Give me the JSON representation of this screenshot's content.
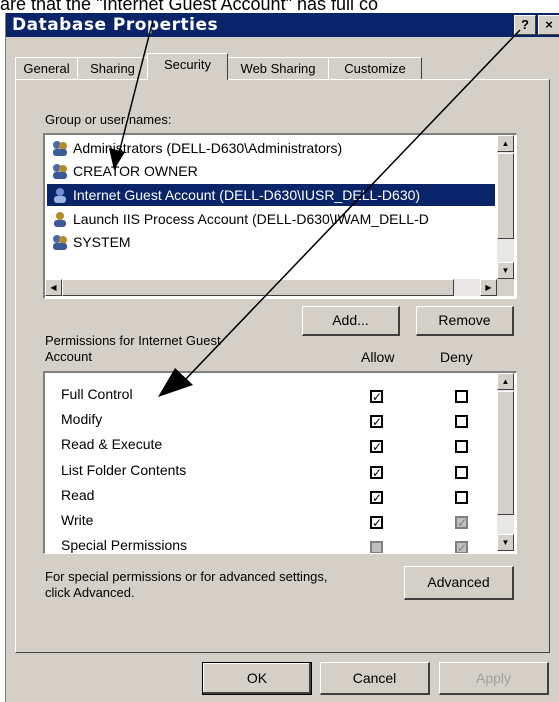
{
  "caption": "are that the \"Internet Guest Account\" has full co",
  "window": {
    "title": "Database Properties",
    "help_btn": "?",
    "close_btn": "×"
  },
  "tabs": [
    "General",
    "Sharing",
    "Security",
    "Web Sharing",
    "Customize"
  ],
  "group_label": "Group or user names:",
  "users": [
    {
      "label": "Administrators (DELL-D630\\Administrators)",
      "selected": false
    },
    {
      "label": "CREATOR OWNER",
      "selected": false
    },
    {
      "label": "Internet Guest Account (DELL-D630\\IUSR_DELL-D630)",
      "selected": true
    },
    {
      "label": "Launch IIS Process Account (DELL-D630\\IWAM_DELL-D",
      "selected": false
    },
    {
      "label": "SYSTEM",
      "selected": false
    }
  ],
  "buttons": {
    "add": "Add...",
    "remove": "Remove",
    "advanced": "Advanced",
    "ok": "OK",
    "cancel": "Cancel",
    "apply": "Apply"
  },
  "permissions_title_1": "Permissions for Internet Guest",
  "permissions_title_2": "Account",
  "allow_header": "Allow",
  "deny_header": "Deny",
  "permissions": [
    {
      "label": "Full Control",
      "allow": "checked",
      "deny": "unchecked"
    },
    {
      "label": "Modify",
      "allow": "checked",
      "deny": "unchecked"
    },
    {
      "label": "Read & Execute",
      "allow": "checked",
      "deny": "unchecked"
    },
    {
      "label": "List Folder Contents",
      "allow": "checked",
      "deny": "unchecked"
    },
    {
      "label": "Read",
      "allow": "checked",
      "deny": "unchecked"
    },
    {
      "label": "Write",
      "allow": "checked",
      "deny": "dim-checked"
    },
    {
      "label": "Special Permissions",
      "allow": "dim-unchecked",
      "deny": "dim-checked"
    }
  ],
  "advanced_text_1": "For special permissions or for advanced settings,",
  "advanced_text_2": "click Advanced.",
  "colors": {
    "titlebar": "#0a246a",
    "face": "#d4d0c8",
    "selection": "#0a246a"
  }
}
